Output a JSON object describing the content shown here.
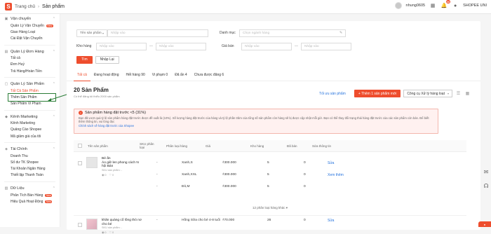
{
  "header": {
    "home_label": "Trang chủ",
    "page_label": "Sản phẩm",
    "username": "nhung0605",
    "shop_label": "SHOPEE UNI",
    "notification_count": "88"
  },
  "sidebar": {
    "sections": [
      {
        "title": "Vận chuyển",
        "items": [
          {
            "label": "Quản Lý Vận Chuyển",
            "new": "New"
          },
          {
            "label": "Giao Hàng Loạt"
          },
          {
            "label": "Cài Đặt Vận Chuyển"
          }
        ]
      },
      {
        "title": "Quản Lý Đơn Hàng",
        "items": [
          {
            "label": "Tất cả"
          },
          {
            "label": "Đơn Huỷ"
          },
          {
            "label": "Trả Hàng/Hoàn Tiền"
          }
        ]
      },
      {
        "title": "Quản Lý Sản Phẩm",
        "items": [
          {
            "label": "Tất Cả Sản Phẩm"
          },
          {
            "label": "Thêm Sản Phẩm"
          },
          {
            "label": "Sản Phẩm Vi Phạm"
          }
        ]
      },
      {
        "title": "Kênh Marketing",
        "items": [
          {
            "label": "Kênh Marketing"
          },
          {
            "label": "Quảng Cáo Shopee"
          },
          {
            "label": "Mã giảm giá của tôi"
          }
        ]
      },
      {
        "title": "Tài Chính",
        "items": [
          {
            "label": "Doanh Thu"
          },
          {
            "label": "Số dư TK Shopee"
          },
          {
            "label": "Tài Khoản Ngân Hàng"
          },
          {
            "label": "Thiết lập Thanh Toán"
          }
        ]
      },
      {
        "title": "Dữ Liệu",
        "items": [
          {
            "label": "Phân Tích Bán Hàng",
            "new": "New"
          },
          {
            "label": "Hiệu Quả Hoạt Động",
            "new": "New"
          }
        ]
      }
    ]
  },
  "filter": {
    "select_name": "Tên sản phẩm",
    "input_placeholder": "Nhập vào",
    "category_label": "Danh mục",
    "category_placeholder": "Chọn ngành hàng",
    "stock_label": "Kho hàng",
    "stock_from": "Nhập vào",
    "stock_to": "Nhập vào",
    "price_label": "Giá bán",
    "price_from": "Nhập vào",
    "price_to": "Nhập vào",
    "search_button": "Tìm",
    "reset_button": "Nhập Lại"
  },
  "tabs": [
    {
      "label": "Tất cả",
      "active": true
    },
    {
      "label": "Đang hoạt động"
    },
    {
      "label": "Hết hàng",
      "count": "90"
    },
    {
      "label": "Vi phạm",
      "count": "0"
    },
    {
      "label": "Đã ẩn",
      "count": "4"
    },
    {
      "label": "Chưa được đăng",
      "count": "6"
    }
  ],
  "list": {
    "count_title": "20 Sản Phẩm",
    "count_sub": "Có thể đăng tối thiểu 2000 sản phẩm",
    "optimize_link": "Tối ưu sản phẩm",
    "add_button": "+ Thêm 1 sản phẩm mới",
    "bulk_tool": "Công cụ Xử lý hàng loạt"
  },
  "warning": {
    "title": "Sản phẩm hàng đặt trước <5 (31%)",
    "body": "Bạn đã vượt quá tỷ lệ sản phẩm hàng đặt trước được đề xuất là (10%). Số lượng hàng đặt trước của hàng và tỷ lệ phần trăm của tổng số sản phẩm còn hàng sẽ bị được cập nhật mỗi giờ. Bạn có thể thay đổi trạng thái hàng đặt trước của các sản phẩm còn bán. Để biết thêm thông tin, vui lòng đọc",
    "link": "Chính sách về hàng đặt trước của Shopee"
  },
  "table": {
    "headers": [
      "Tên sản phẩm",
      "SKU phân loại",
      "Phân loại hàng",
      "Giá",
      "Kho hàng",
      "Đã bán",
      "Sửa thông tin"
    ],
    "rows": [
      {
        "name": "Áo giữ len phong cách N hội Bán",
        "tag": "Bé ấn",
        "sku": "SKU sản phẩm: -",
        "views": "0",
        "likes": "0",
        "variations": [
          {
            "sku": "-",
            "name": "Xanh,S",
            "price": "₫300.000",
            "stock": "5",
            "sold": "0"
          },
          {
            "sku": "-",
            "name": "Xanh,XXL",
            "price": "₫300.000",
            "stock": "5",
            "sold": "0"
          },
          {
            "sku": "-",
            "name": "Đỏ,M",
            "price": "₫300.000",
            "stock": "5",
            "sold": "0"
          }
        ],
        "edit": "Sửa",
        "more": "Xem thêm"
      },
      {
        "name": "khăn quàng cổ lông thỏ nơ cho bé",
        "sku": "SKU sản phẩm: -",
        "views": "0",
        "likes": "0",
        "variations": [
          {
            "sku": "-",
            "name": "Hồng Sữa cho bé 4-8 tuổi",
            "price": "₫70.000",
            "stock": "26",
            "sold": "0"
          }
        ],
        "edit": "Sửa"
      }
    ],
    "more_variations": "12 phân loại hàng khác"
  },
  "colors": {
    "accent": "#ee4d2d",
    "link": "#2673dd",
    "highlight": "#2a7d36"
  }
}
